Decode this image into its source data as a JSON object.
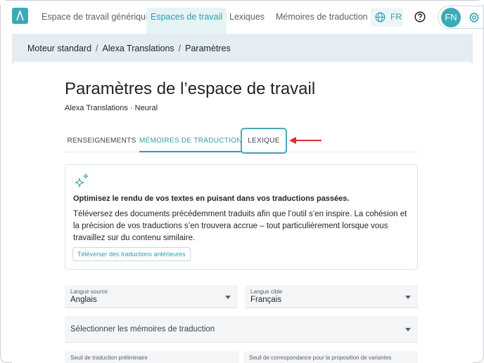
{
  "nav": {
    "items": [
      {
        "label": "Espace de travail générique",
        "active": false
      },
      {
        "label": "Espaces de travail",
        "active": true
      },
      {
        "label": "Lexiques",
        "active": false
      },
      {
        "label": "Mémoires de traduction",
        "active": false
      }
    ],
    "language": "FR",
    "avatar_initials": "FN"
  },
  "breadcrumb": {
    "items": [
      "Moteur standard",
      "Alexa Translations",
      "Paramètres"
    ],
    "separator": "/"
  },
  "page": {
    "title": "Paramètres de l’espace de travail",
    "subtitle": "Alexa Translations · Neural"
  },
  "tabs": [
    {
      "label": "RENSEIGNEMENTS",
      "active": false
    },
    {
      "label": "MÉMOIRES DE TRADUCTION",
      "active": true
    },
    {
      "label": "LEXIQUE",
      "active": false,
      "highlighted": true
    }
  ],
  "info": {
    "heading": "Optimisez le rendu de vos textes en puisant dans vos traductions passées.",
    "body": "Téléversez des documents précédemment traduits afin que l’outil s’en inspire. La cohésion et la précision de vos traductions s’en trouvera accrue – tout particulièrement lorsque vous travaillez sur du contenu similaire.",
    "upload_label": "Téléverser des traductions antérieures"
  },
  "form": {
    "source_label": "Langue source",
    "source_value": "Anglais",
    "target_label": "Langue cible",
    "target_value": "Français",
    "memories_placeholder": "Sélectionner les mémoires de traduction",
    "threshold_label": "Seuil de traduction préliminaire",
    "match_label": "Seuil de correspondance pour la proposition de variantes"
  },
  "colors": {
    "accent": "#2b9eb0",
    "page_background": "#e4edf1",
    "annotation_arrow": "#d9302c"
  }
}
